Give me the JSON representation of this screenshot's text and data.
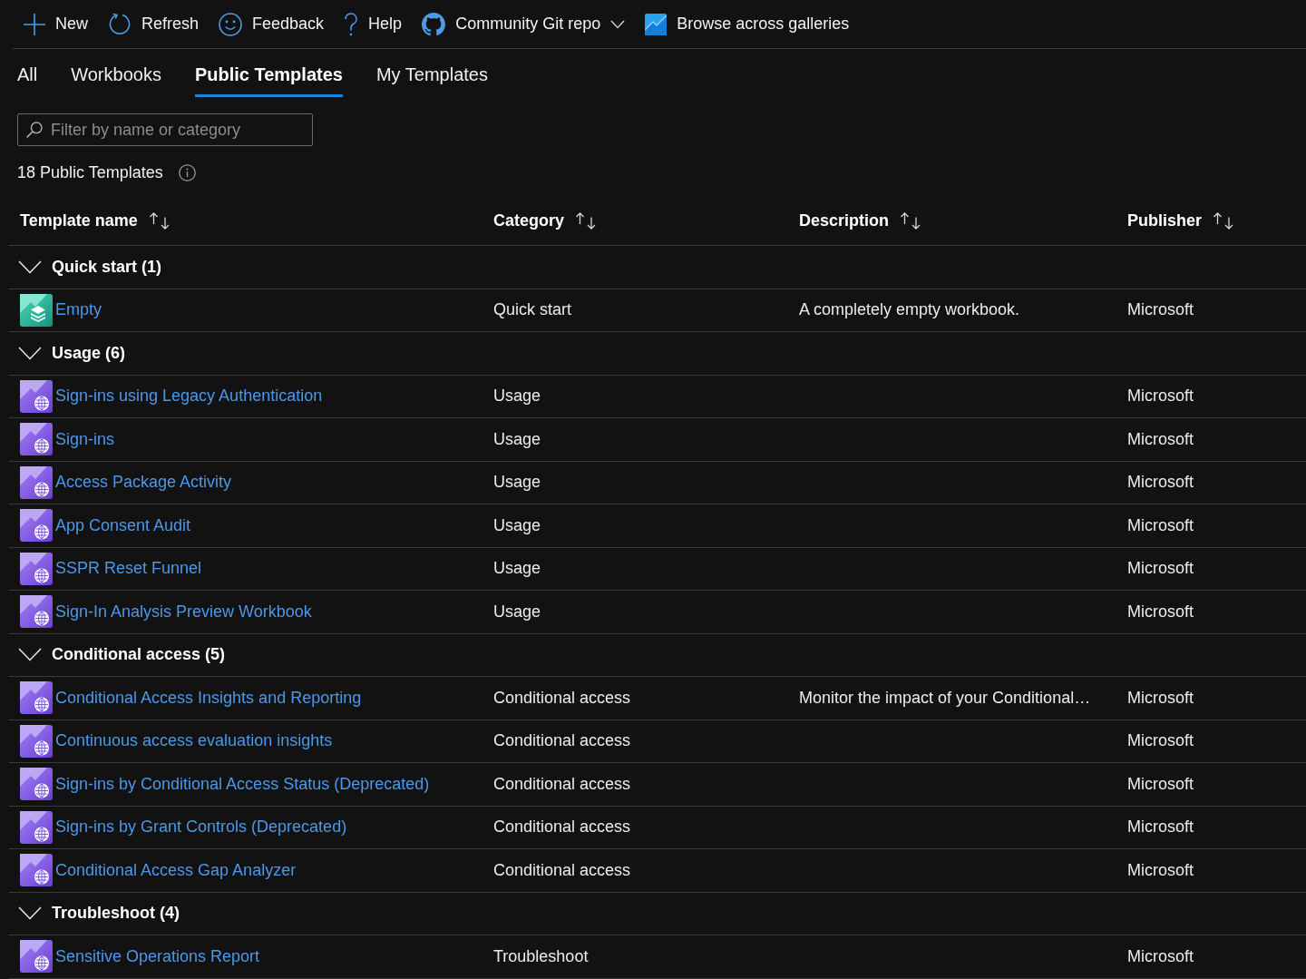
{
  "toolbar": [
    {
      "label": "New",
      "kind": "plus",
      "dropdown": false
    },
    {
      "label": "Refresh",
      "kind": "refresh",
      "dropdown": false
    },
    {
      "label": "Feedback",
      "kind": "feedback",
      "dropdown": false
    },
    {
      "label": "Help",
      "kind": "help",
      "dropdown": false
    },
    {
      "label": "Community Git repo",
      "kind": "repo",
      "dropdown": true
    },
    {
      "label": "Browse across galleries",
      "kind": "gallery",
      "dropdown": false
    }
  ],
  "tabs": [
    {
      "label": "All",
      "selected": false
    },
    {
      "label": "Workbooks",
      "selected": false
    },
    {
      "label": "Public Templates",
      "selected": true
    },
    {
      "label": "My Templates",
      "selected": false
    }
  ],
  "filter": {
    "placeholder": "Filter by name or category"
  },
  "result_count": "18 Public Templates",
  "table": {
    "columns": [
      {
        "label": "Template name"
      },
      {
        "label": "Category"
      },
      {
        "label": "Description"
      },
      {
        "label": "Publisher"
      }
    ],
    "groups": [
      {
        "title": "Quick start (1)",
        "expanded": true,
        "rows": [
          {
            "kind": "empty",
            "name": "Empty",
            "category": "Quick start",
            "description": "A completely empty workbook.",
            "publisher": "Microsoft"
          }
        ]
      },
      {
        "title": "Usage (6)",
        "expanded": true,
        "rows": [
          {
            "kind": "workbook",
            "name": "Sign-ins using Legacy Authentication",
            "category": "Usage",
            "publisher": "Microsoft"
          },
          {
            "kind": "workbook",
            "name": "Sign-ins",
            "category": "Usage",
            "publisher": "Microsoft"
          },
          {
            "kind": "workbook",
            "name": "Access Package Activity",
            "category": "Usage",
            "publisher": "Microsoft"
          },
          {
            "kind": "workbook",
            "name": "App Consent Audit",
            "category": "Usage",
            "publisher": "Microsoft"
          },
          {
            "kind": "workbook",
            "name": "SSPR Reset Funnel",
            "category": "Usage",
            "publisher": "Microsoft"
          },
          {
            "kind": "workbook",
            "name": "Sign-In Analysis Preview Workbook",
            "category": "Usage",
            "publisher": "Microsoft"
          }
        ]
      },
      {
        "title": "Conditional access (5)",
        "expanded": true,
        "rows": [
          {
            "kind": "workbook",
            "name": "Conditional Access Insights and Reporting",
            "category": "Conditional access",
            "description": "Monitor the impact of your Conditional…",
            "publisher": "Microsoft"
          },
          {
            "kind": "workbook",
            "name": "Continuous access evaluation insights",
            "category": "Conditional access",
            "publisher": "Microsoft"
          },
          {
            "kind": "workbook",
            "name": "Sign-ins by Conditional Access Status (Deprecated)",
            "category": "Conditional access",
            "publisher": "Microsoft"
          },
          {
            "kind": "workbook",
            "name": "Sign-ins by Grant Controls (Deprecated)",
            "category": "Conditional access",
            "publisher": "Microsoft"
          },
          {
            "kind": "workbook",
            "name": "Conditional Access Gap Analyzer",
            "category": "Conditional access",
            "publisher": "Microsoft"
          }
        ]
      },
      {
        "title": "Troubleshoot (4)",
        "expanded": true,
        "rows": [
          {
            "kind": "workbook",
            "name": "Sensitive Operations Report",
            "category": "Troubleshoot",
            "publisher": "Microsoft"
          }
        ]
      }
    ]
  }
}
